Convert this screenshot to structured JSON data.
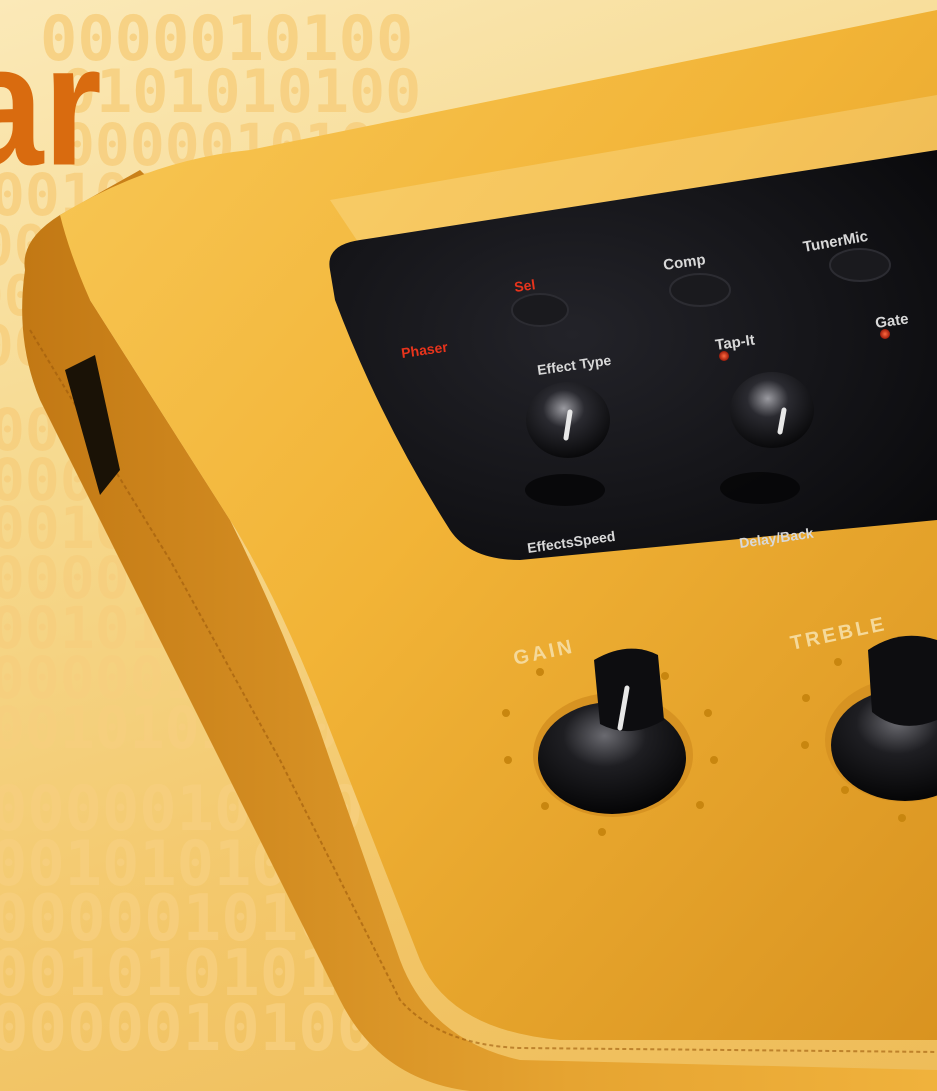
{
  "headline_fragment": "ar",
  "background_binary": [
    "0000010100",
    "0101010100",
    "0000010100",
    "0010101010",
    "0000010100",
    "0010101010",
    "0000010100",
    "0010101010",
    "0000010100",
    "0010101010",
    "0000010100",
    "0010101010",
    "0000010100",
    "0010101010",
    "0000010100",
    "0010101010",
    "0000010100",
    "0010101010",
    "0000010100"
  ],
  "panel": {
    "button_labels": {
      "sel": "Sel",
      "comp": "Comp",
      "tuner": "TunerMic",
      "phaser": "Phaser",
      "effect_type": "Effect Type",
      "tap_it": "Tap-It",
      "gate": "Gate",
      "effects_speed": "EffectsSpeed",
      "delay": "Delay/Back"
    },
    "knob_labels": {
      "gain": "GAIN",
      "treble": "TREBLE"
    }
  },
  "colors": {
    "device_body": "#f2b437",
    "panel_dark": "#141418",
    "led_red": "#e8341c",
    "title_orange": "#d96b0f"
  }
}
